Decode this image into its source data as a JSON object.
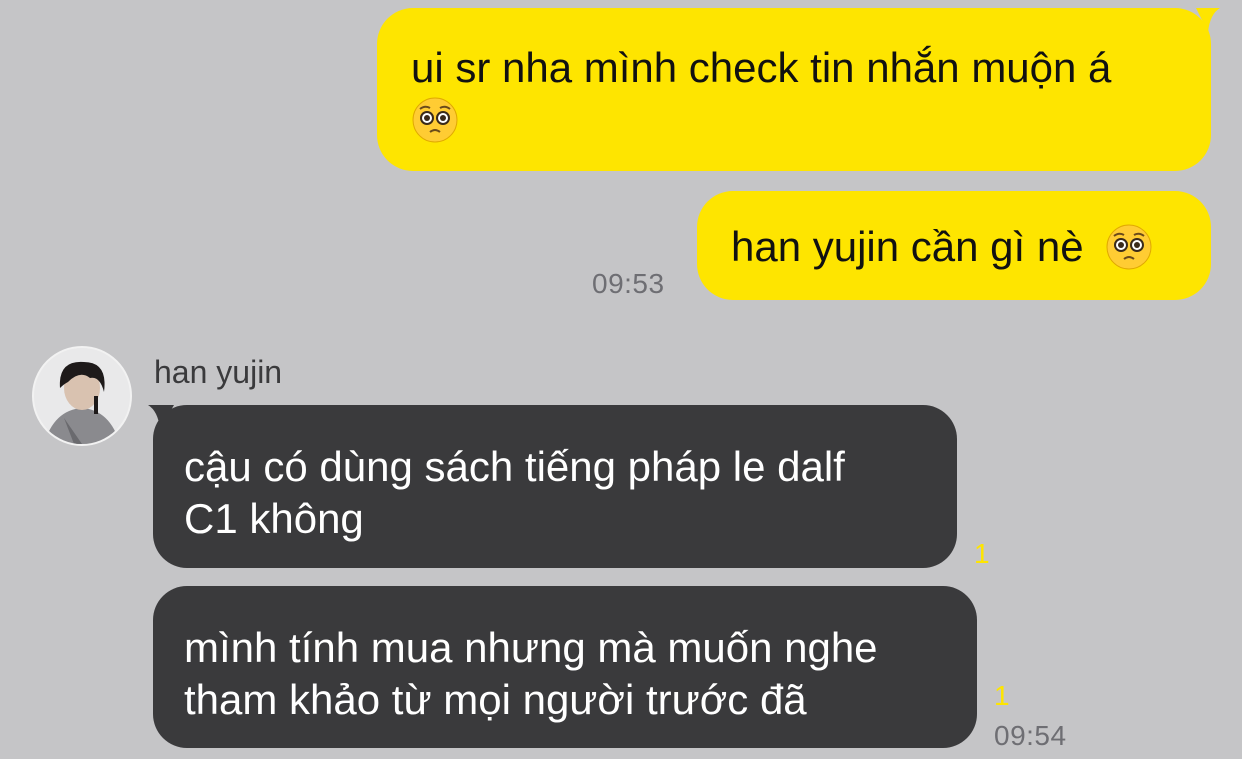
{
  "messages": {
    "m1": {
      "line1": "ui sr nha mình check tin nhắn muộn á",
      "emoji": "pleading-face-icon"
    },
    "m2": {
      "text": "han yujin cần gì nè",
      "emoji": "pleading-face-icon",
      "time": "09:53"
    },
    "sender": {
      "name": "han yujin"
    },
    "m3": {
      "line1": "cậu có dùng sách tiếng pháp le dalf",
      "line2": "C1 không",
      "unread": "1"
    },
    "m4": {
      "line1": "mình tính mua nhưng mà muốn nghe",
      "line2": "tham khảo từ mọi người trước đã",
      "unread": "1",
      "time": "09:54"
    }
  },
  "colors": {
    "background": "#c5c5c7",
    "outgoing_bubble": "#fee500",
    "incoming_bubble": "#3a3a3c",
    "unread_count": "#fee500",
    "timestamp": "#6e6e73"
  }
}
